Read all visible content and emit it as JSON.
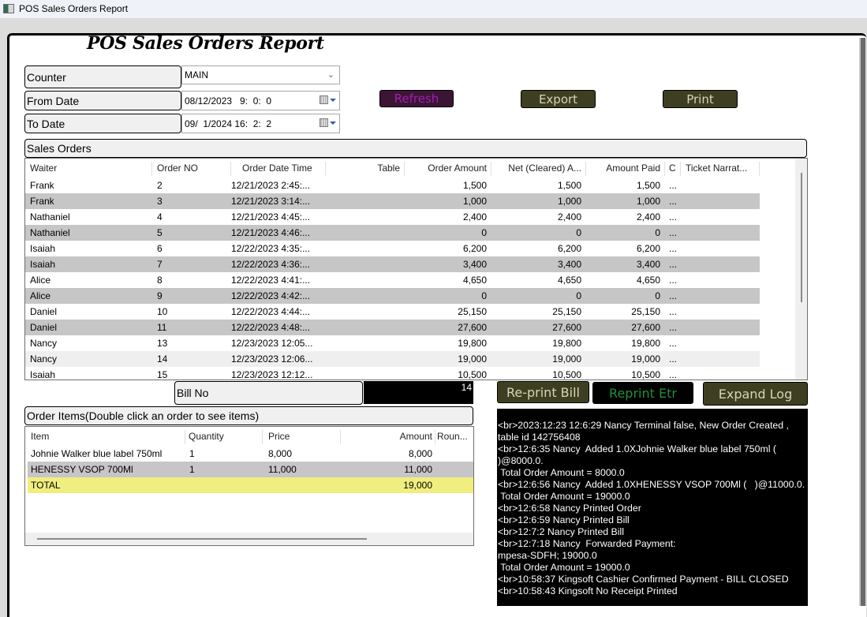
{
  "window": {
    "title": "POS Sales Orders Report"
  },
  "heading": "POS Sales Orders Report",
  "filters": {
    "counter_label": "Counter",
    "counter_value": "MAIN",
    "from_label": "From Date",
    "from_value": "08/12/2023   9:  0:  0",
    "to_label": "To Date",
    "to_value": "09/  1/2024 16:  2:  2"
  },
  "buttons": {
    "refresh": "Refresh",
    "export": "Export",
    "print": "Print",
    "reprint_bill": "Re-print Bill",
    "reprint_etr": "Reprint Etr",
    "expand_log": "Expand Log"
  },
  "colors": {
    "olive_button": "#3e3e22",
    "refresh_button": "#3c1535",
    "refresh_text": "#a020b0",
    "reprint_etr_text": "#1f8f3a",
    "alt_row": "#c6c6c6",
    "total_row": "#f0ee7e"
  },
  "sales_orders": {
    "section_label": "Sales Orders",
    "columns": [
      "Waiter",
      "Order NO",
      "Order Date Time",
      "Table",
      "Order Amount",
      "Net (Cleared) A...",
      "Amount Paid",
      "C",
      "Ticket Narrat..."
    ],
    "rows": [
      {
        "waiter": "Frank",
        "order_no": "2",
        "datetime": "12/21/2023 2:45:...",
        "table": "",
        "order_amount": "1,500",
        "net": "1,500",
        "paid": "1,500",
        "c": "...",
        "narration": ""
      },
      {
        "waiter": "Frank",
        "order_no": "3",
        "datetime": "12/21/2023 3:14:...",
        "table": "",
        "order_amount": "1,000",
        "net": "1,000",
        "paid": "1,000",
        "c": "...",
        "narration": ""
      },
      {
        "waiter": "Nathaniel",
        "order_no": "4",
        "datetime": "12/21/2023 4:45:...",
        "table": "",
        "order_amount": "2,400",
        "net": "2,400",
        "paid": "2,400",
        "c": "...",
        "narration": ""
      },
      {
        "waiter": "Nathaniel",
        "order_no": "5",
        "datetime": "12/21/2023 4:46:...",
        "table": "",
        "order_amount": "0",
        "net": "0",
        "paid": "0",
        "c": "...",
        "narration": ""
      },
      {
        "waiter": "Isaiah",
        "order_no": "6",
        "datetime": "12/22/2023 4:35:...",
        "table": "",
        "order_amount": "6,200",
        "net": "6,200",
        "paid": "6,200",
        "c": "...",
        "narration": ""
      },
      {
        "waiter": "Isaiah",
        "order_no": "7",
        "datetime": "12/22/2023 4:36:...",
        "table": "",
        "order_amount": "3,400",
        "net": "3,400",
        "paid": "3,400",
        "c": "...",
        "narration": ""
      },
      {
        "waiter": "Alice",
        "order_no": "8",
        "datetime": "12/22/2023 4:41:...",
        "table": "",
        "order_amount": "4,650",
        "net": "4,650",
        "paid": "4,650",
        "c": "...",
        "narration": ""
      },
      {
        "waiter": "Alice",
        "order_no": "9",
        "datetime": "12/22/2023 4:42:...",
        "table": "",
        "order_amount": "0",
        "net": "0",
        "paid": "0",
        "c": "...",
        "narration": ""
      },
      {
        "waiter": "Daniel",
        "order_no": "10",
        "datetime": "12/22/2023 4:44:...",
        "table": "",
        "order_amount": "25,150",
        "net": "25,150",
        "paid": "25,150",
        "c": "...",
        "narration": ""
      },
      {
        "waiter": "Daniel",
        "order_no": "11",
        "datetime": "12/22/2023 4:48:...",
        "table": "",
        "order_amount": "27,600",
        "net": "27,600",
        "paid": "27,600",
        "c": "...",
        "narration": ""
      },
      {
        "waiter": "Nancy",
        "order_no": "13",
        "datetime": "12/23/2023 12:05...",
        "table": "",
        "order_amount": "19,800",
        "net": "19,800",
        "paid": "19,800",
        "c": "...",
        "narration": ""
      },
      {
        "waiter": "Nancy",
        "order_no": "14",
        "datetime": "12/23/2023 12:06...",
        "table": "",
        "order_amount": "19,000",
        "net": "19,000",
        "paid": "19,000",
        "c": "...",
        "narration": "",
        "selected": true
      },
      {
        "waiter": "Isaiah",
        "order_no": "15",
        "datetime": "12/23/2023 12:12...",
        "table": "",
        "order_amount": "10,500",
        "net": "10,500",
        "paid": "10,500",
        "c": "...",
        "narration": ""
      }
    ]
  },
  "bill": {
    "label": "Bill No",
    "value": "14"
  },
  "order_items": {
    "section_label": "Order Items(Double click an order to see items)",
    "columns": [
      "Item",
      "Quantity",
      "Price",
      "Amount",
      "Roun..."
    ],
    "rows": [
      {
        "item": "Johnie Walker blue label 750ml",
        "qty": "1",
        "price": "8,000",
        "amount": "8,000",
        "round": ""
      },
      {
        "item": "HENESSY VSOP 700Ml",
        "qty": "1",
        "price": "11,000",
        "amount": "11,000",
        "round": ""
      },
      {
        "item": "TOTAL",
        "qty": "",
        "price": "",
        "amount": "19,000",
        "round": "",
        "total": true
      }
    ]
  },
  "log": {
    "lines": [
      "<br>2023:12:23 12:6:29 Nancy Terminal false, New Order Created ,",
      "table id 142756408",
      "<br>12:6:35 Nancy  Added 1.0XJohnie Walker blue label 750ml (",
      ")@8000.0.",
      " Total Order Amount = 8000.0",
      "<br>12:6:56 Nancy  Added 1.0XHENESSY VSOP 700Ml (   )@11000.0.",
      " Total Order Amount = 19000.0",
      "<br>12:6:58 Nancy Printed Order",
      "<br>12:6:59 Nancy Printed Bill",
      "<br>12:7:2 Nancy Printed Bill",
      "<br>12:7:18 Nancy  Forwarded Payment:",
      "mpesa-SDFH; 19000.0",
      " Total Order Amount = 19000.0",
      "<br>10:58:37 Kingsoft Cashier Confirmed Payment - BILL CLOSED",
      "<br>10:58:43 Kingsoft No Receipt Printed"
    ]
  }
}
